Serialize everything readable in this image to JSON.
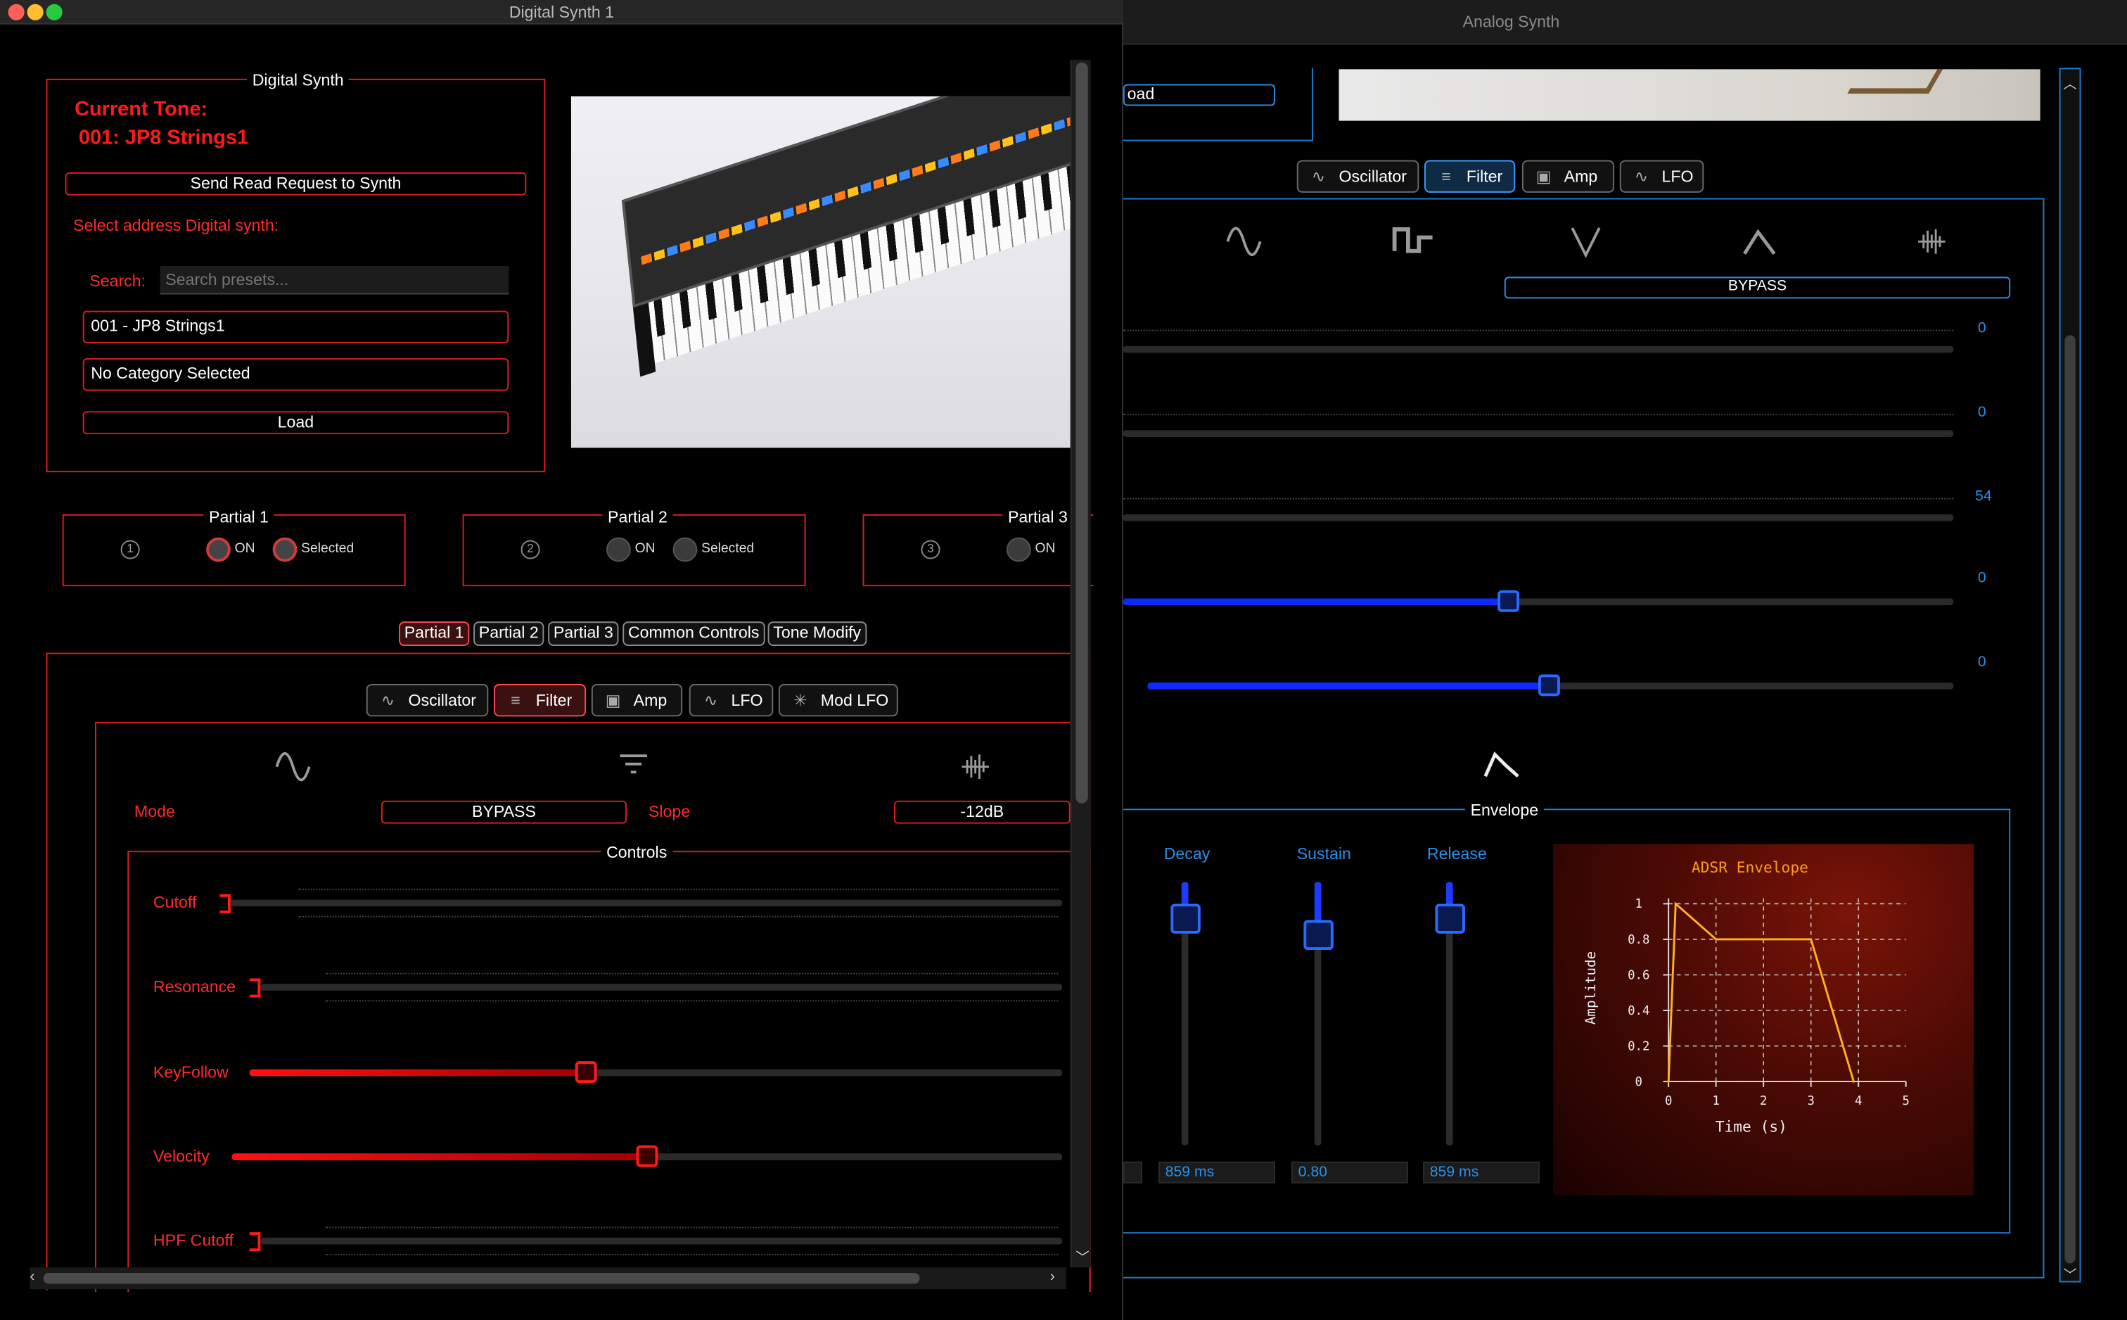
{
  "digital": {
    "window_title": "Digital Synth 1",
    "group_title": "Digital Synth",
    "current_tone_label": "Current Tone:",
    "current_tone_value": "001: JP8 Strings1",
    "read_request_btn": "Send Read Request to Synth",
    "select_address_label": "Select address Digital synth:",
    "search_label": "Search:",
    "search_placeholder": "Search presets...",
    "preset_value": "001 - JP8 Strings1",
    "category_value": "No Category Selected",
    "load_btn": "Load",
    "partials": [
      {
        "title": "Partial 1",
        "num": "1",
        "on_label": "ON",
        "selected_label": "Selected",
        "on": true,
        "selected": true
      },
      {
        "title": "Partial 2",
        "num": "2",
        "on_label": "ON",
        "selected_label": "Selected",
        "on": false,
        "selected": false
      },
      {
        "title": "Partial 3",
        "num": "3",
        "on_label": "ON",
        "on": false
      }
    ],
    "top_tabs": [
      "Partial 1",
      "Partial 2",
      "Partial 3",
      "Common Controls",
      "Tone Modify"
    ],
    "sub_tabs": [
      "Oscillator",
      "Filter",
      "Amp",
      "LFO",
      "Mod LFO"
    ],
    "mode_label": "Mode",
    "mode_value": "BYPASS",
    "slope_label": "Slope",
    "slope_value": "-12dB",
    "controls_title": "Controls",
    "sliders": [
      {
        "label": "Cutoff",
        "value_pct": 0
      },
      {
        "label": "Resonance",
        "value_pct": 0
      },
      {
        "label": "KeyFollow",
        "value_pct": 40
      },
      {
        "label": "Velocity",
        "value_pct": 50
      },
      {
        "label": "HPF Cutoff",
        "value_pct": 0
      }
    ]
  },
  "analog": {
    "window_title": "Analog Synth",
    "load_btn_partial": "oad",
    "tabs": [
      "Oscillator",
      "Filter",
      "Amp",
      "LFO"
    ],
    "filter_mode": "BYPASS",
    "slider_values": [
      "0",
      "0",
      "54",
      "0",
      "0"
    ],
    "envelope_title": "Envelope",
    "env_labels": [
      "Decay",
      "Sustain",
      "Release"
    ],
    "env_values": [
      "859 ms",
      "0.80",
      "859 ms"
    ],
    "chart_title": "ADSR Envelope",
    "colors": {
      "accent_blue": "#2a8fe8",
      "accent_red": "#e01b1b",
      "curve": "#ffb21e"
    }
  },
  "chart_data": {
    "type": "line",
    "title": "ADSR Envelope",
    "xlabel": "Time (s)",
    "ylabel": "Amplitude",
    "x_ticks": [
      "0",
      "1",
      "2",
      "3",
      "4",
      "5"
    ],
    "y_ticks": [
      "0",
      "0.2",
      "0.4",
      "0.6",
      "0.8",
      "1"
    ],
    "xlim": [
      0,
      5
    ],
    "ylim": [
      0,
      1
    ],
    "grid": true,
    "series": [
      {
        "x": [
          0,
          0.15,
          1.0,
          3.0,
          3.9
        ],
        "y": [
          0,
          1.0,
          0.8,
          0.8,
          0
        ]
      }
    ]
  }
}
